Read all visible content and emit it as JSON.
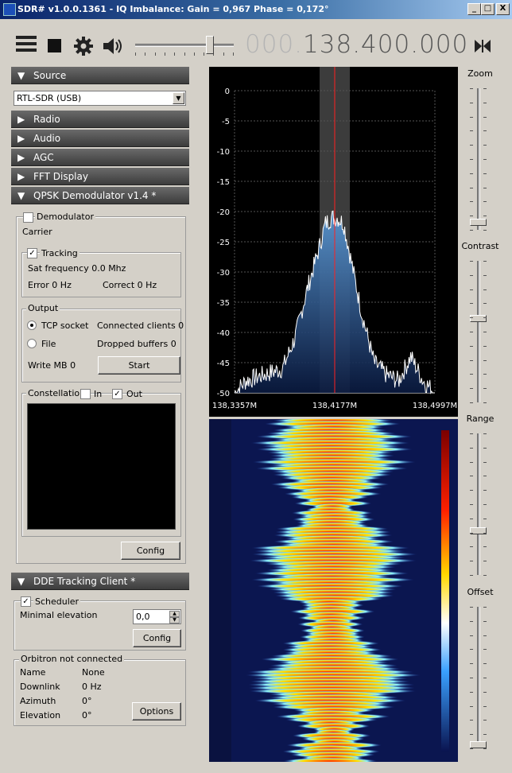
{
  "window": {
    "title": "SDR# v1.0.0.1361 - IQ Imbalance: Gain = 0,967 Phase = 0,172°",
    "buttons": {
      "minimize": "_",
      "maximize": "□",
      "close": "X"
    }
  },
  "toolbar": {
    "icons": [
      "menu-icon",
      "stop-icon",
      "gear-icon",
      "speaker-icon",
      "tune-icon"
    ],
    "volume_level": 0.78,
    "frequency_dim": "000.",
    "frequency": "138.400.000"
  },
  "source": {
    "header": "Source",
    "device": "RTL-SDR (USB)"
  },
  "panels": [
    "Radio",
    "Audio",
    "AGC",
    "FFT Display"
  ],
  "qpsk": {
    "header": "QPSK Demodulator v1.4 *",
    "demodulator_label": "Demodulator",
    "demodulator_checked": false,
    "carrier_label": "Carrier",
    "tracking_label": "Tracking",
    "tracking_checked": true,
    "sat_frequency": "Sat frequency 0.0 Mhz",
    "error": "Error 0 Hz",
    "correct": "Correct 0 Hz",
    "output_legend": "Output",
    "tcp_label": "TCP socket",
    "tcp_selected": true,
    "file_label": "File",
    "connected_clients": "Connected clients 0",
    "dropped_buffers": "Dropped buffers 0",
    "write_mb": "Write MB 0",
    "start_button": "Start",
    "constellation_legend": "Constellation",
    "in_label": "In",
    "in_checked": false,
    "out_label": "Out",
    "out_checked": true,
    "config_button": "Config"
  },
  "dde": {
    "header": "DDE Tracking Client *",
    "scheduler_label": "Scheduler",
    "scheduler_checked": true,
    "min_elevation_label": "Minimal elevation",
    "min_elevation_value": "0,0",
    "config_button": "Config",
    "orbitron_legend": "Orbitron not connected",
    "rows": [
      {
        "label": "Name",
        "value": "None"
      },
      {
        "label": "Downlink",
        "value": "0 Hz"
      },
      {
        "label": "Azimuth",
        "value": "0°"
      },
      {
        "label": "Elevation",
        "value": "0°"
      }
    ],
    "options_button": "Options"
  },
  "chart_data": {
    "type": "line",
    "title": "",
    "xlabel": "",
    "ylabel": "",
    "ylim": [
      -50,
      0
    ],
    "yticks": [
      "0",
      "-5",
      "-10",
      "-15",
      "-20",
      "-25",
      "-30",
      "-35",
      "-40",
      "-45",
      "-50"
    ],
    "xticks": [
      "138,3357M",
      "138,4177M",
      "138,4997M"
    ],
    "x_unit": "MHz",
    "x": [
      138.3357,
      138.345,
      138.36,
      138.375,
      138.385,
      138.395,
      138.405,
      138.41,
      138.415,
      138.42,
      138.425,
      138.43,
      138.44,
      138.45,
      138.46,
      138.47,
      138.48,
      138.49,
      138.4997
    ],
    "series": [
      {
        "values": [
          -50,
          -48,
          -47,
          -46,
          -41,
          -33,
          -26,
          -22,
          -21,
          -21,
          -22,
          -27,
          -37,
          -45,
          -47,
          -48,
          -44,
          -48,
          -50
        ]
      }
    ],
    "marker_frequency_mhz": 138.4177,
    "colors": {
      "background": "#000000",
      "grid": "#555555",
      "trace": "#ffffff",
      "fill": "#3b6fb0",
      "marker": "#ff2020"
    }
  },
  "sliders": {
    "zoom": {
      "label": "Zoom",
      "level": 0.03
    },
    "contrast": {
      "label": "Contrast",
      "level": 0.6
    },
    "range": {
      "label": "Range",
      "level": 0.3
    },
    "offset": {
      "label": "Offset",
      "level": 0.0
    }
  }
}
